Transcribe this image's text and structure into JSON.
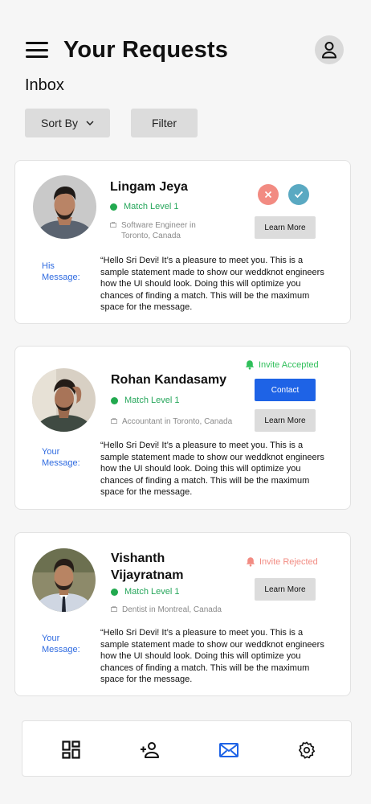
{
  "header": {
    "title": "Your Requests"
  },
  "inbox": {
    "title": "Inbox"
  },
  "controls": {
    "sort_label": "Sort By",
    "filter_label": "Filter"
  },
  "requests": [
    {
      "name_line1": "Lingam Jeya",
      "name_line2": "",
      "match": "Match Level 1",
      "job_line1": "Software Engineer in",
      "job_line2": "Toronto, Canada",
      "message_label_line1": "His",
      "message_label_line2": "Message:",
      "message": "“Hello Sri Devi! It’s a pleasure to meet you. This is a sample statement made to show our weddknot engineers how the UI should look. Doing this will optimize you chances  of finding a match. This will be the maximum space for the message.",
      "learn_more": "Learn More"
    },
    {
      "name_line1": "Rohan Kandasamy",
      "name_line2": "",
      "match": "Match Level 1",
      "job_line1": "Accountant in Toronto, Canada",
      "job_line2": "",
      "status": "Invite Accepted",
      "contact": "Contact",
      "message_label_line1": "Your",
      "message_label_line2": "Message:",
      "message": "“Hello Sri Devi! It’s a pleasure to meet you. This is a sample statement made to show our weddknot engineers how the UI should look. Doing this will optimize you chances  of finding a match. This will be the maximum space for the message.",
      "learn_more": "Learn More"
    },
    {
      "name_line1": "Vishanth",
      "name_line2": "Vijayratnam",
      "match": "Match Level 1",
      "job_line1": "Dentist in Montreal, Canada",
      "job_line2": "",
      "status": "Invite Rejected",
      "message_label_line1": "Your",
      "message_label_line2": "Message:",
      "message": "“Hello Sri Devi! It’s a pleasure to meet you. This is a sample statement made to show our weddknot engineers how the UI should look. Doing this will optimize you chances  of finding a match. This will be the maximum space for the message.",
      "learn_more": "Learn More"
    }
  ],
  "nav": {
    "items": [
      "dashboard-icon",
      "add-user-icon",
      "mail-icon",
      "settings-icon"
    ],
    "active": "mail-icon"
  },
  "colors": {
    "accent": "#1e63e6",
    "match_green": "#26a65b",
    "accepted_green": "#2fbf5a",
    "rejected_red": "#f28b82",
    "reject_button": "#f28b82",
    "accept_button": "#5aa9c2"
  }
}
